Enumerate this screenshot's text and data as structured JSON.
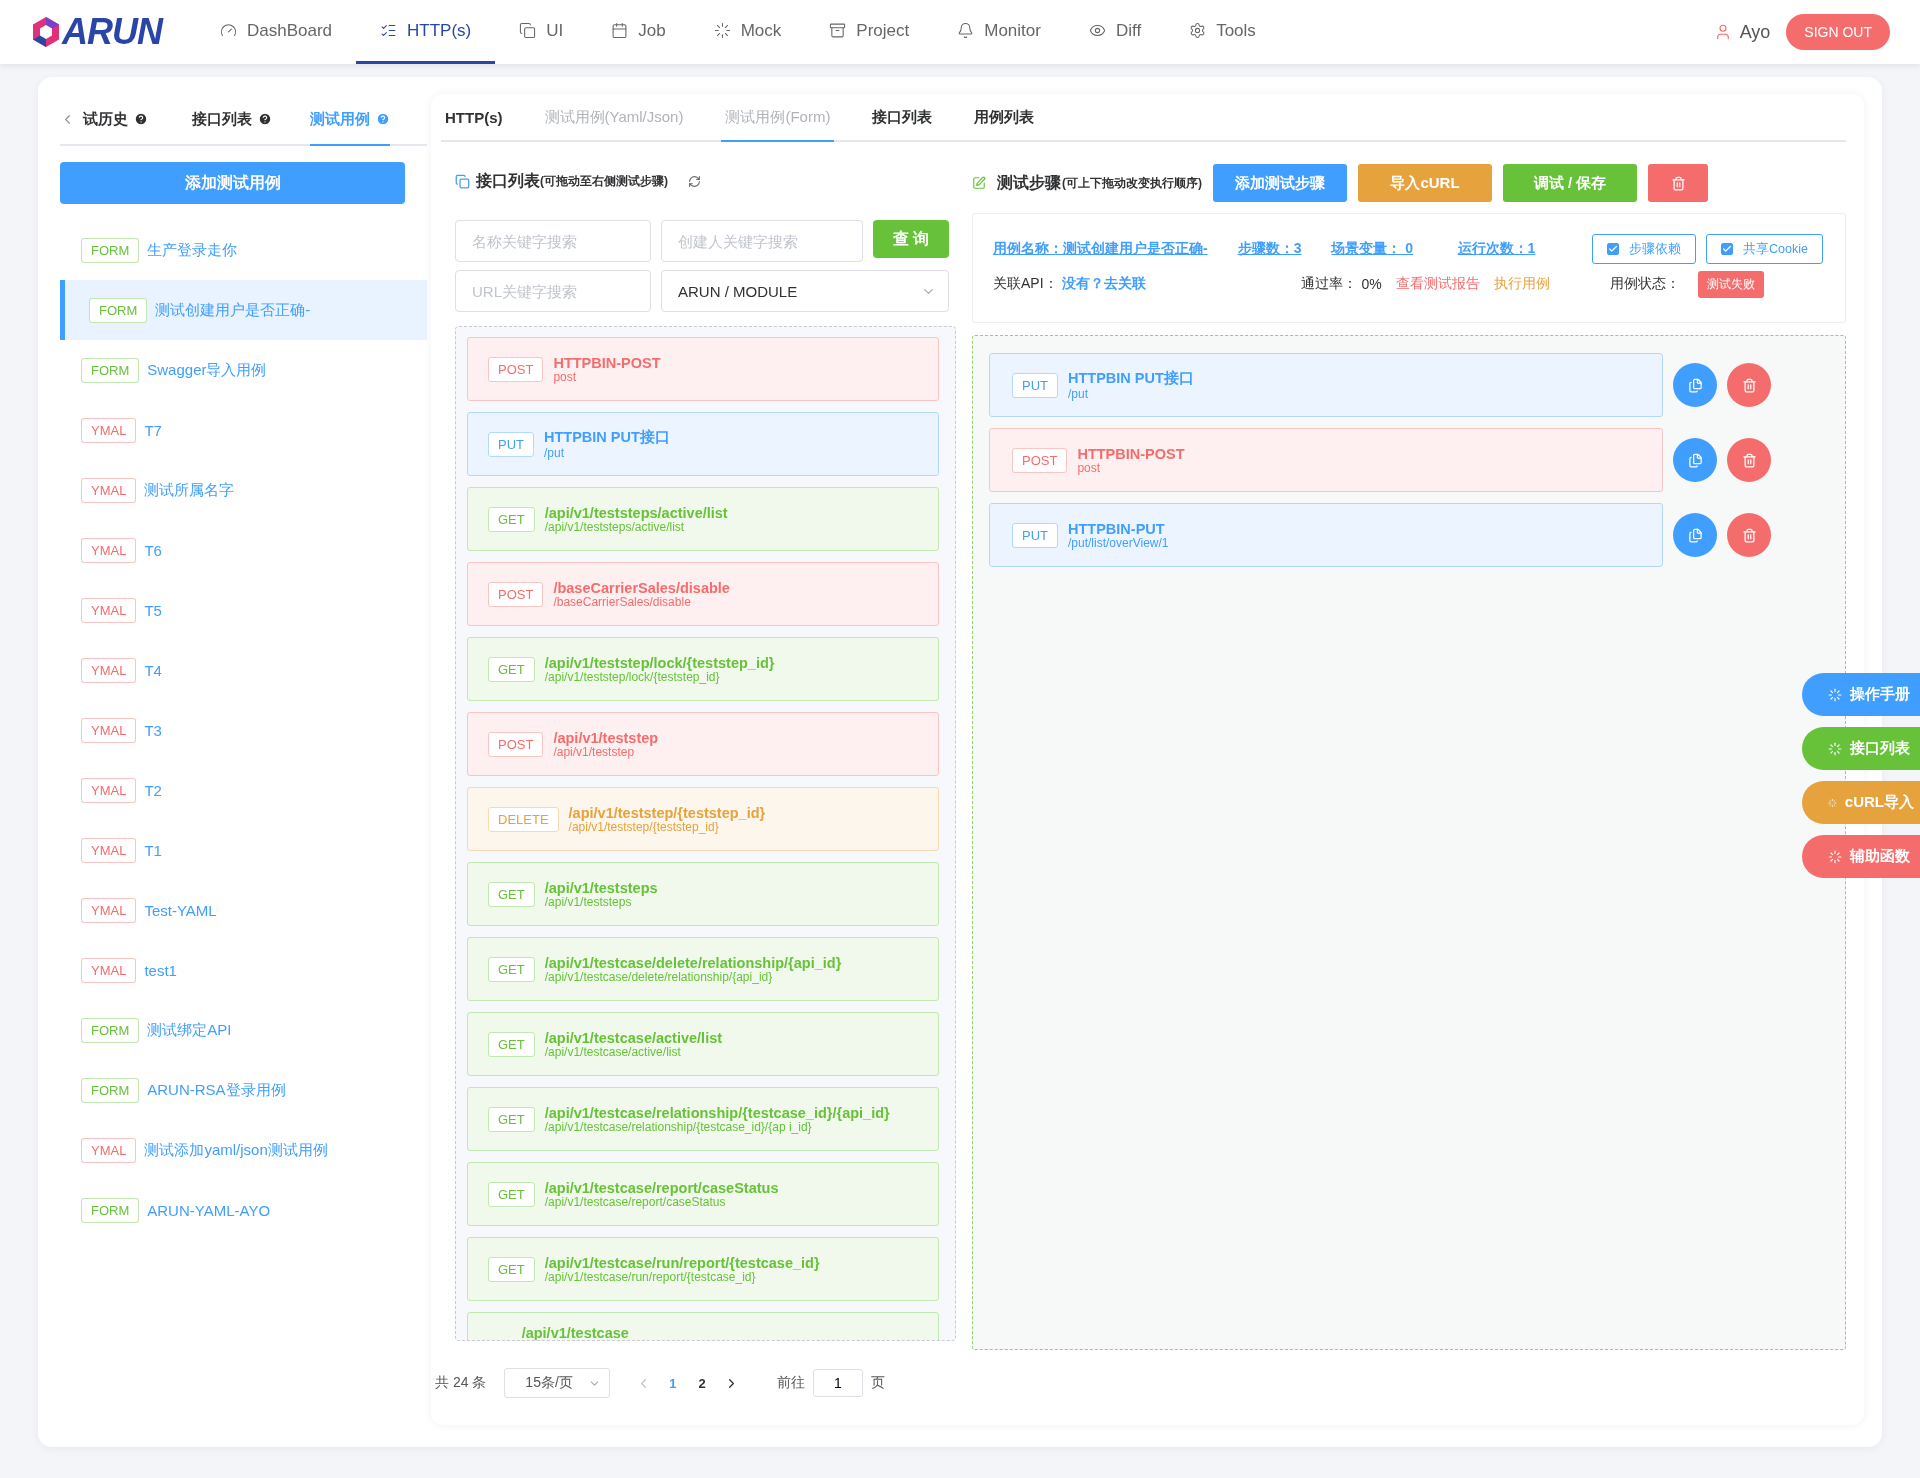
{
  "nav": {
    "logo": "ARUN",
    "items": [
      {
        "label": "DashBoard",
        "selected": false
      },
      {
        "label": "HTTP(s)",
        "selected": true
      },
      {
        "label": "UI",
        "selected": false
      },
      {
        "label": "Job",
        "selected": false
      },
      {
        "label": "Mock",
        "selected": false
      },
      {
        "label": "Project",
        "selected": false
      },
      {
        "label": "Monitor",
        "selected": false
      },
      {
        "label": "Diff",
        "selected": false
      },
      {
        "label": "Tools",
        "selected": false
      }
    ],
    "user": "Ayo",
    "sign_out": "SIGN OUT"
  },
  "sidebar": {
    "tabs": [
      {
        "label": "试历史",
        "selected": false
      },
      {
        "label": "接口列表",
        "selected": false
      },
      {
        "label": "测试用例",
        "selected": true
      }
    ],
    "add_button": "添加测试用例",
    "items": [
      {
        "kind": "form",
        "tag": "FORM",
        "name": "生产登录走你",
        "selected": false
      },
      {
        "kind": "form",
        "tag": "FORM",
        "name": "测试创建用户是否正确-",
        "selected": true
      },
      {
        "kind": "form",
        "tag": "FORM",
        "name": "Swagger导入用例",
        "selected": false
      },
      {
        "kind": "yaml",
        "tag": "YMAL",
        "name": "T7",
        "selected": false
      },
      {
        "kind": "yaml",
        "tag": "YMAL",
        "name": "测试所属名字",
        "selected": false
      },
      {
        "kind": "yaml",
        "tag": "YMAL",
        "name": "T6",
        "selected": false
      },
      {
        "kind": "yaml",
        "tag": "YMAL",
        "name": "T5",
        "selected": false
      },
      {
        "kind": "yaml",
        "tag": "YMAL",
        "name": "T4",
        "selected": false
      },
      {
        "kind": "yaml",
        "tag": "YMAL",
        "name": "T3",
        "selected": false
      },
      {
        "kind": "yaml",
        "tag": "YMAL",
        "name": "T2",
        "selected": false
      },
      {
        "kind": "yaml",
        "tag": "YMAL",
        "name": "T1",
        "selected": false
      },
      {
        "kind": "yaml",
        "tag": "YMAL",
        "name": "Test-YAML",
        "selected": false
      },
      {
        "kind": "yaml",
        "tag": "YMAL",
        "name": "test1",
        "selected": false
      },
      {
        "kind": "form",
        "tag": "FORM",
        "name": "测试绑定API",
        "selected": false
      },
      {
        "kind": "form",
        "tag": "FORM",
        "name": "ARUN-RSA登录用例",
        "selected": false
      },
      {
        "kind": "yaml",
        "tag": "YMAL",
        "name": "测试添加yaml/json测试用例",
        "selected": false
      },
      {
        "kind": "form",
        "tag": "FORM",
        "name": "ARUN-YAML-AYO",
        "selected": false
      }
    ]
  },
  "tabs": [
    {
      "label": "HTTP(s)",
      "selected": false,
      "disabled": false
    },
    {
      "label": "测试用例(Yaml/Json)",
      "selected": false,
      "disabled": true
    },
    {
      "label": "测试用例(Form)",
      "selected": true,
      "disabled": true
    },
    {
      "label": "接口列表",
      "selected": false,
      "disabled": false
    },
    {
      "label": "用例列表",
      "selected": false,
      "disabled": false
    }
  ],
  "api_list": {
    "title": "接口列表",
    "hint": "(可拖动至右侧测试步骤)",
    "search": [
      {
        "placeholder": "名称关键字搜索"
      },
      {
        "placeholder": "创建人关键字搜索"
      },
      {
        "placeholder": "URL关键字搜索"
      }
    ],
    "query_button": "查 询",
    "module_select": "ARUN / MODULE",
    "items": [
      {
        "kind": "post",
        "method": "POST",
        "title": "HTTPBIN-POST",
        "path": "post"
      },
      {
        "kind": "put",
        "method": "PUT",
        "title": "HTTPBIN PUT接口",
        "path": "/put"
      },
      {
        "kind": "get",
        "method": "GET",
        "title": "/api/v1/teststeps/active/list",
        "path": "/api/v1/teststeps/active/list"
      },
      {
        "kind": "post",
        "method": "POST",
        "title": "/baseCarrierSales/disable",
        "path": "/baseCarrierSales/disable"
      },
      {
        "kind": "get",
        "method": "GET",
        "title": "/api/v1/teststep/lock/{teststep_id}",
        "path": "/api/v1/teststep/lock/{teststep_id}"
      },
      {
        "kind": "post",
        "method": "POST",
        "title": "/api/v1/teststep",
        "path": "/api/v1/teststep"
      },
      {
        "kind": "delete",
        "method": "DELETE",
        "title": "/api/v1/teststep/{teststep_id}",
        "path": "/api/v1/teststep/{teststep_id}"
      },
      {
        "kind": "get",
        "method": "GET",
        "title": "/api/v1/teststeps",
        "path": "/api/v1/teststeps"
      },
      {
        "kind": "get",
        "method": "GET",
        "title": "/api/v1/testcase/delete/relationship/{api_id}",
        "path": "/api/v1/testcase/delete/relationship/{api_id}"
      },
      {
        "kind": "get",
        "method": "GET",
        "title": "/api/v1/testcase/active/list",
        "path": "/api/v1/testcase/active/list"
      },
      {
        "kind": "get",
        "method": "GET",
        "title": "/api/v1/testcase/relationship/{testcase_id}/{api_id}",
        "path": "/api/v1/testcase/relationship/{testcase_id}/{ap i_id}"
      },
      {
        "kind": "get",
        "method": "GET",
        "title": "/api/v1/testcase/report/caseStatus",
        "path": "/api/v1/testcase/report/caseStatus"
      },
      {
        "kind": "get",
        "method": "GET",
        "title": "/api/v1/testcase/run/report/{testcase_id}",
        "path": "/api/v1/testcase/run/report/{testcase_id}"
      },
      {
        "kind": "get",
        "title": "/api/v1/testcase"
      }
    ],
    "pagination": {
      "total": "共 24 条",
      "page_size": "15条/页",
      "pages": [
        {
          "label": "1",
          "selected": true
        },
        {
          "label": "2",
          "selected": false
        }
      ],
      "goto_label": "前往",
      "goto_value": "1",
      "page_unit": "页"
    }
  },
  "steps": {
    "title": "测试步骤",
    "hint": "(可上下拖动改变执行顺序)",
    "buttons": [
      {
        "kind": "primary",
        "label": "添加测试步骤"
      },
      {
        "kind": "warning",
        "label": "导入cURL"
      },
      {
        "kind": "success",
        "label": "调试 / 保存"
      },
      {
        "kind": "danger"
      }
    ],
    "info": {
      "case_name": "用例名称：测试创建用户是否正确-",
      "step_count": "步骤数：3",
      "scene_vars": "场景变量： 0",
      "run_count": "运行次数：1",
      "options": [
        {
          "label": "步骤依赖",
          "checked": true
        },
        {
          "label": "共享Cookie",
          "checked": true
        }
      ],
      "linked_api_label": "关联API：",
      "linked_api_link": "没有？去关联",
      "pass_rate_label": "通过率：",
      "pass_rate": "0%",
      "report_link": "查看测试报告",
      "run_link": "执行用例",
      "status_label": "用例状态：",
      "status": "测试失败"
    },
    "items": [
      {
        "kind": "put",
        "method": "PUT",
        "title": "HTTPBIN PUT接口",
        "path": "/put"
      },
      {
        "kind": "post",
        "method": "POST",
        "title": "HTTPBIN-POST",
        "path": "post"
      },
      {
        "kind": "put",
        "method": "PUT",
        "title": "HTTPBIN-PUT",
        "path": "/put/list/overView/1"
      }
    ]
  },
  "float_buttons": [
    {
      "label": "操作手册",
      "color": "#409eff"
    },
    {
      "label": "接口列表",
      "color": "#67c23a"
    },
    {
      "label": "cURL导入",
      "color": "#e6a23c"
    },
    {
      "label": "辅助函数",
      "color": "#f56c6c"
    }
  ]
}
